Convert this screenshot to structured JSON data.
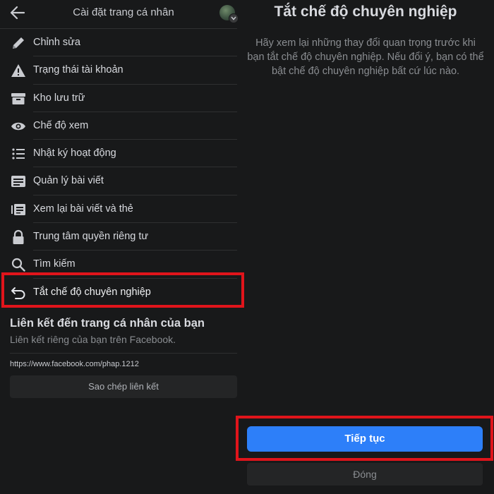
{
  "header": {
    "title": "Cài đặt trang cá nhân",
    "back_icon": "arrow-left-icon",
    "avatar_badge_icon": "chevron-down-icon"
  },
  "menu": {
    "items": [
      {
        "label": "Chỉnh sửa",
        "icon": "pencil-icon"
      },
      {
        "label": "Trạng thái tài khoản",
        "icon": "warning-icon"
      },
      {
        "label": "Kho lưu trữ",
        "icon": "archive-icon"
      },
      {
        "label": "Chế độ xem",
        "icon": "eye-icon"
      },
      {
        "label": "Nhật ký hoạt động",
        "icon": "list-icon"
      },
      {
        "label": "Quản lý bài viết",
        "icon": "posts-icon"
      },
      {
        "label": "Xem lại bài viết và thẻ",
        "icon": "review-tags-icon"
      },
      {
        "label": "Trung tâm quyền riêng tư",
        "icon": "lock-icon"
      },
      {
        "label": "Tìm kiếm",
        "icon": "search-icon"
      },
      {
        "label": "Tắt chế độ chuyên nghiệp",
        "icon": "undo-arrow-icon"
      }
    ]
  },
  "profile_link": {
    "title": "Liên kết đến trang cá nhân của bạn",
    "subtitle": "Liên kết riêng của bạn trên Facebook.",
    "url": "https://www.facebook.com/phap.1212",
    "copy_label": "Sao chép liên kết"
  },
  "dialog": {
    "title": "Tắt chế độ chuyên nghiệp",
    "description": "Hãy xem lại những thay đổi quan trọng trước khi bạn tắt chế độ chuyên nghiệp. Nếu đổi ý, bạn có thể bật chế độ chuyên nghiệp bất cứ lúc nào.",
    "continue_label": "Tiếp tục",
    "close_label": "Đóng"
  },
  "colors": {
    "background": "#18191a",
    "highlight": "#e0141b",
    "primary_button": "#2d7ff9",
    "secondary_button": "#242526"
  }
}
